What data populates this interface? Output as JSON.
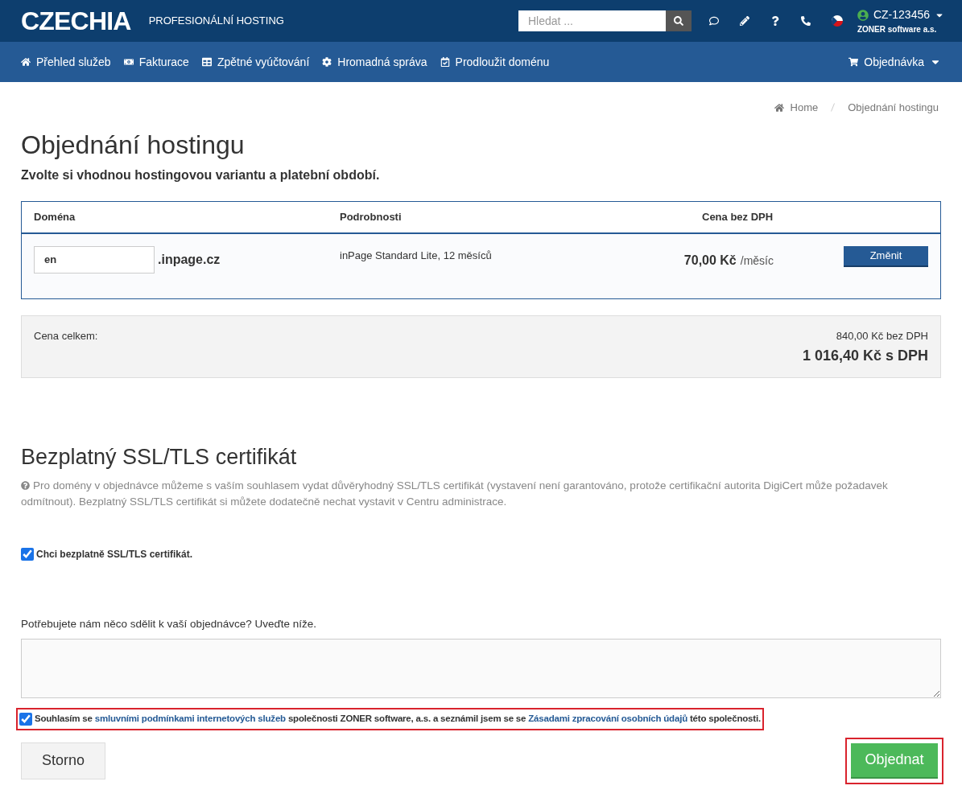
{
  "header": {
    "logo": "CZECHIA",
    "tagline": "PROFESIONÁLNÍ HOSTING",
    "search": {
      "placeholder": "Hledat ..."
    },
    "account": {
      "id": "CZ-123456",
      "company": "ZONER software a.s."
    }
  },
  "nav": {
    "items": [
      {
        "label": "Přehled služeb"
      },
      {
        "label": "Fakturace"
      },
      {
        "label": "Zpětné vyúčtování"
      },
      {
        "label": "Hromadná správa"
      },
      {
        "label": "Prodloužit doménu"
      }
    ],
    "order": "Objednávka"
  },
  "breadcrumb": [
    "Home",
    "Objednání hostingu"
  ],
  "title": "Objednání hostingu",
  "subtitle": "Zvolte si vhodnou hostingovou variantu a platební období.",
  "table": {
    "columns": [
      "Doména",
      "Podrobnosti",
      "Cena bez DPH"
    ],
    "row": {
      "domain_value": "en",
      "domain_suffix": ".inpage.cz",
      "details": "inPage Standard Lite, 12 měsíců",
      "price": "70,00 Kč",
      "period": "/měsíc",
      "button": "Změnit"
    }
  },
  "total": {
    "label": "Cena celkem:",
    "net": "840,00 Kč bez DPH",
    "gross": "1 016,40 Kč s DPH"
  },
  "ssl": {
    "title": "Bezplatný SSL/TLS certifikát",
    "info": "Pro domény v objednávce můžeme s vaším souhlasem vydat důvěryhodný SSL/TLS certifikát (vystavení není garantováno, protože certifikační autorita DigiCert může požadavek odmítnout). Bezplatný SSL/TLS certifikát si můžete dodatečně nechat vystavit v Centru administrace.",
    "checkbox": {
      "label": "Chci bezplatně SSL/TLS certifikát.",
      "checked": true
    }
  },
  "note": {
    "label": "Potřebujete nám něco sdělit k vaší objednávce? Uveďte níže."
  },
  "consent": {
    "checked": true,
    "highlighted": true,
    "parts": [
      {
        "kind": "text",
        "text": "Souhlasím se "
      },
      {
        "kind": "link",
        "text": "smluvními podmínkami internetových služeb"
      },
      {
        "kind": "text",
        "text": " společnosti ZONER software, a.s. a seznámil jsem se se "
      },
      {
        "kind": "link",
        "text": "Zásadami zpracování osobních údajů"
      },
      {
        "kind": "text",
        "text": " této společnosti."
      }
    ]
  },
  "actions": {
    "cancel": "Storno",
    "submit": {
      "label": "Objednat",
      "highlighted": true
    }
  }
}
